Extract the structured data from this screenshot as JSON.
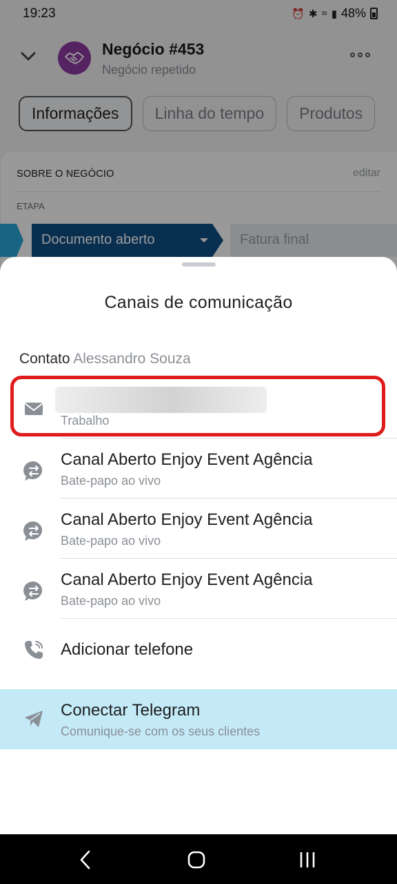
{
  "status_bar": {
    "time": "19:23",
    "battery": "48%"
  },
  "header": {
    "title": "Negócio #453",
    "subtitle": "Negócio repetido"
  },
  "tabs": [
    {
      "label": "Informações"
    },
    {
      "label": "Linha do tempo"
    },
    {
      "label": "Produtos"
    }
  ],
  "card": {
    "section_title": "SOBRE O NEGÓCIO",
    "edit_label": "editar",
    "stage_label": "ETAPA",
    "current_stage": "Documento aberto",
    "next_stage": "Fatura final"
  },
  "sheet": {
    "title": "Canais de comunicação",
    "contact_prefix": "Contato",
    "contact_name": "Alessandro Souza",
    "email_row": {
      "type": "Trabalho"
    },
    "channels": [
      {
        "name": "Canal Aberto Enjoy Event Agência",
        "type": "Bate-papo ao vivo"
      },
      {
        "name": "Canal Aberto Enjoy Event Agência",
        "type": "Bate-papo ao vivo"
      },
      {
        "name": "Canal Aberto Enjoy Event Agência",
        "type": "Bate-papo ao vivo"
      }
    ],
    "add_phone": "Adicionar telefone",
    "telegram": {
      "title": "Conectar Telegram",
      "subtitle": "Comunique-se com os seus clientes"
    }
  },
  "icons": {
    "email": "mail-icon",
    "channel": "chat-transfer-icon",
    "phone": "phone-icon",
    "telegram": "send-icon"
  },
  "colors": {
    "accent_stage": "#0f4f86",
    "stage_prev": "#2aa7d9",
    "avatar": "#8e3ba4",
    "highlight": "#e01b1b",
    "telegram_bg": "#c4eaf8"
  }
}
